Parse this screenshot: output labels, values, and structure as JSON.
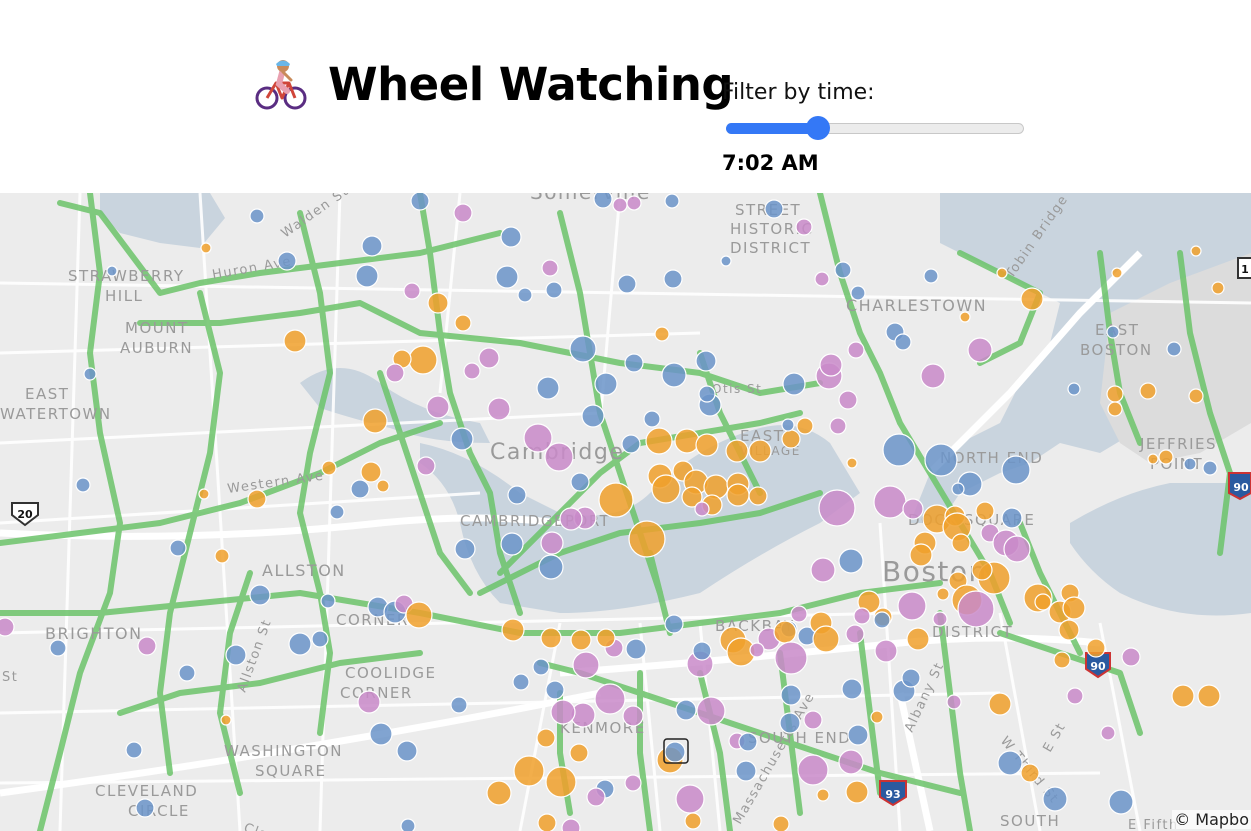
{
  "header": {
    "logo_icon": "person-biking-icon",
    "title": "Wheel Watching",
    "filter_label": "Filter by time:",
    "slider_value": 0.31,
    "time": "7:02 AM"
  },
  "colors": {
    "accent": "#3478f6",
    "bike_lane": "#6cc46a",
    "water": "#c9d4de",
    "station_blue": "#6b94c9",
    "station_orange": "#f0a02c",
    "station_purple": "#c98ac9"
  },
  "map": {
    "place_labels": [
      "Somerville",
      "STREET",
      "HISTORIC",
      "DISTRICT",
      "STRAWBERRY",
      "HILL",
      "MOUNT",
      "AUBURN",
      "EAST",
      "WATERTOWN",
      "CHARLESTOWN",
      "EAST",
      "BOSTON",
      "JEFFRIES",
      "POINT",
      "Cambridge",
      "CAMBRIDGEPORT",
      "ALLSTON",
      "BRIGHTON",
      "BACKBAY",
      "CORNER",
      "COOLIDGE",
      "CORNER",
      "KENMORE",
      "WASHINGTON",
      "SQUARE",
      "CLEVELAND",
      "CIRCLE",
      "Boston",
      "NORTH END",
      "DOCK SQUARE",
      "DISTRICT",
      "SOUTH END",
      "SOUTH",
      "EAST",
      "VILLAGE"
    ],
    "road_labels": [
      "Walden St",
      "Huron Ave",
      "Tobin Bridge",
      "Otis St",
      "Western Ave",
      "Allston St",
      "Albany St",
      "Massachusetts Ave",
      "W Third St",
      "E St",
      "E Fifth",
      "St",
      "Clar"
    ],
    "shields": [
      "20",
      "90",
      "90",
      "93",
      "1"
    ],
    "attribution": "© Mapbo"
  }
}
